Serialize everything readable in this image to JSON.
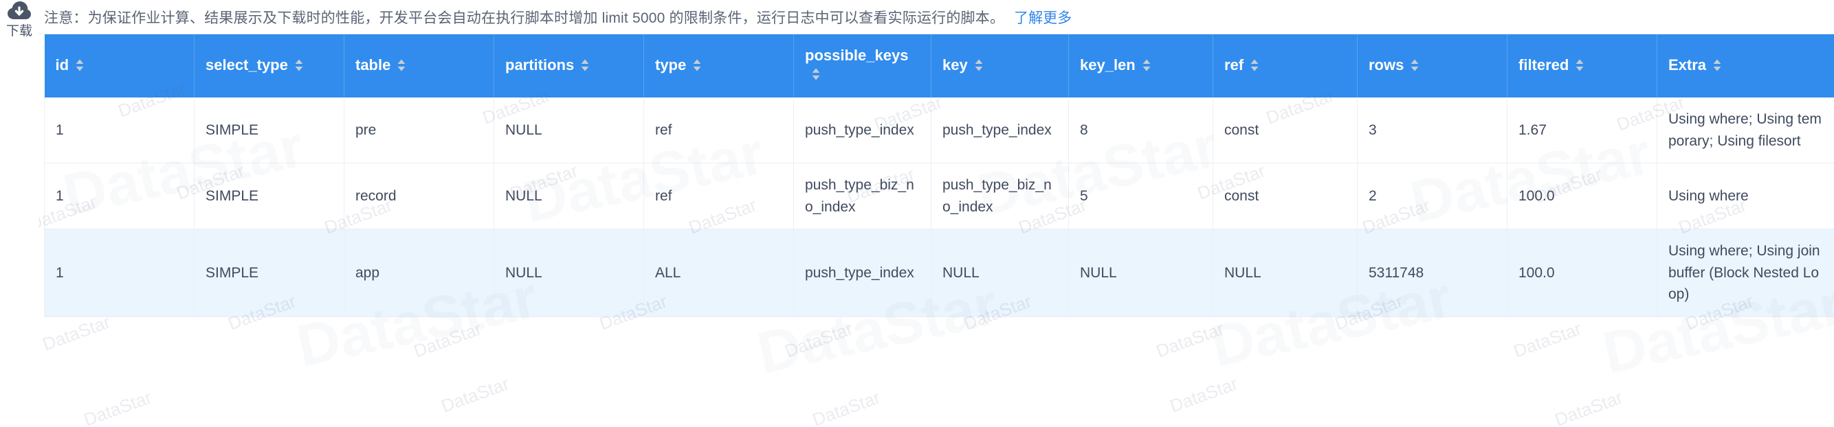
{
  "sidebar": {
    "download": {
      "icon": "cloud-download-icon",
      "label": "下载"
    }
  },
  "notice": {
    "text": "注意：为保证作业计算、结果展示及下载时的性能，开发平台会自动在执行脚本时增加 limit 5000 的限制条件，运行日志中可以查看实际运行的脚本。",
    "link_label": "了解更多",
    "link_color": "#2f86eb",
    "text_color": "#5a6475"
  },
  "table": {
    "header_bg": "#318ced",
    "header_fg": "#ffffff",
    "highlight_row_bg": "#eaf5fe",
    "sort_icon": "sort-updown-icon",
    "columns": [
      {
        "key": "id",
        "label": "id",
        "sortable": true
      },
      {
        "key": "select_type",
        "label": "select_type",
        "sortable": true
      },
      {
        "key": "table",
        "label": "table",
        "sortable": true
      },
      {
        "key": "partitions",
        "label": "partitions",
        "sortable": true
      },
      {
        "key": "type",
        "label": "type",
        "sortable": true
      },
      {
        "key": "possible_keys",
        "label": "possible_keys",
        "sortable": true
      },
      {
        "key": "key",
        "label": "key",
        "sortable": true
      },
      {
        "key": "key_len",
        "label": "key_len",
        "sortable": true
      },
      {
        "key": "ref",
        "label": "ref",
        "sortable": true
      },
      {
        "key": "rows",
        "label": "rows",
        "sortable": true
      },
      {
        "key": "filtered",
        "label": "filtered",
        "sortable": true
      },
      {
        "key": "Extra",
        "label": "Extra",
        "sortable": true
      }
    ],
    "rows": [
      {
        "highlighted": false,
        "id": "1",
        "select_type": "SIMPLE",
        "table": "pre",
        "partitions": "NULL",
        "type": "ref",
        "possible_keys": "push_type_index",
        "key": "push_type_index",
        "key_len": "8",
        "ref": "const",
        "rows": "3",
        "filtered": "1.67",
        "Extra": "Using where; Using temporary; Using filesort"
      },
      {
        "highlighted": false,
        "id": "1",
        "select_type": "SIMPLE",
        "table": "record",
        "partitions": "NULL",
        "type": "ref",
        "possible_keys": "push_type_biz_no_index",
        "key": "push_type_biz_no_index",
        "key_len": "5",
        "ref": "const",
        "rows": "2",
        "filtered": "100.0",
        "Extra": "Using where"
      },
      {
        "highlighted": true,
        "id": "1",
        "select_type": "SIMPLE",
        "table": "app",
        "partitions": "NULL",
        "type": "ALL",
        "possible_keys": "push_type_index",
        "key": "NULL",
        "key_len": "NULL",
        "ref": "NULL",
        "rows": "5311748",
        "filtered": "100.0",
        "Extra": "Using where; Using join buffer (Block Nested Loop)"
      }
    ]
  },
  "watermark": {
    "text": "DataStar"
  }
}
